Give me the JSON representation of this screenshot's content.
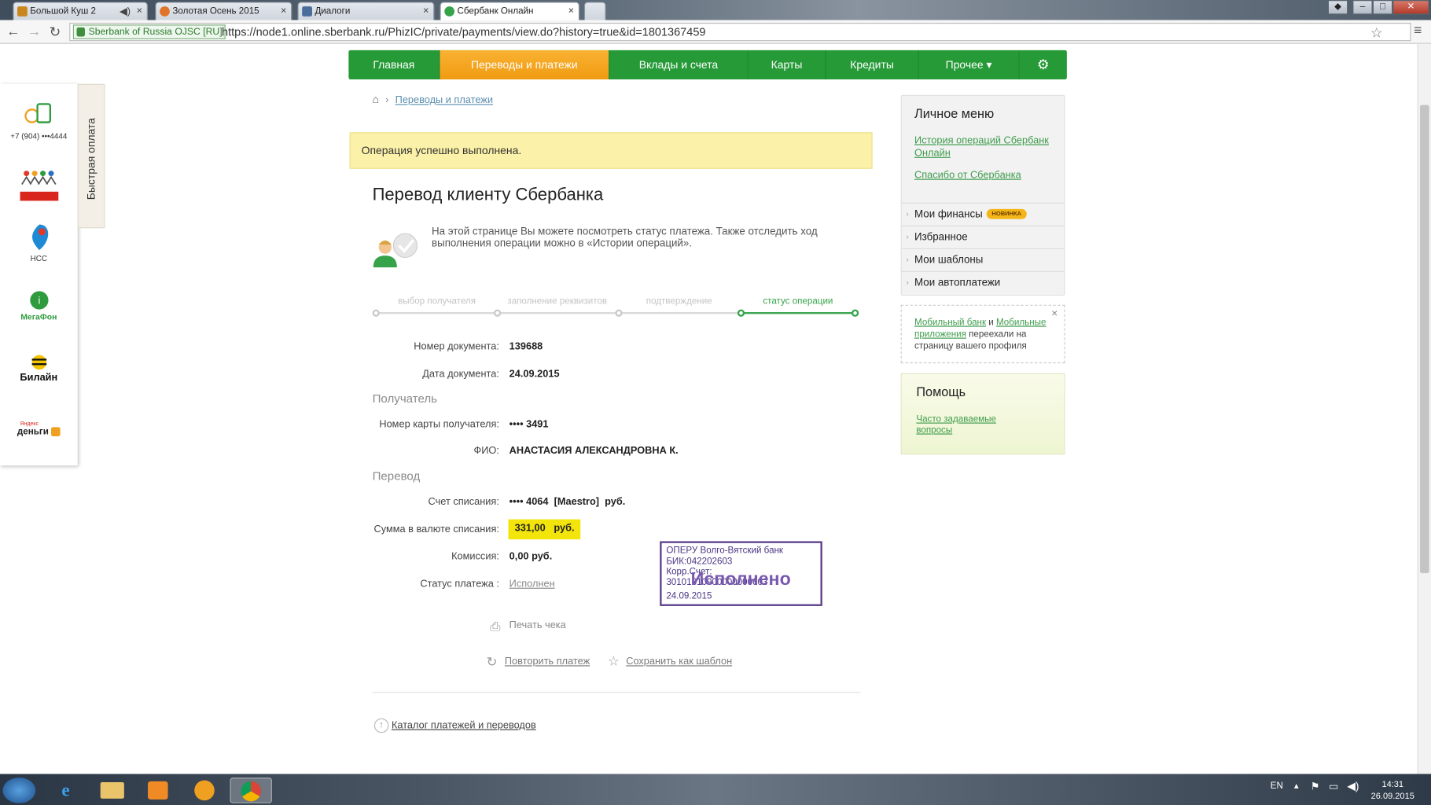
{
  "browser": {
    "tabs": [
      {
        "title": "Большой Куш 2",
        "audio": "◀) ",
        "close": "×"
      },
      {
        "title": "Золотая Осень 2015",
        "close": "×"
      },
      {
        "title": "Диалоги",
        "close": "×"
      },
      {
        "title": "Сбербанк Онлайн",
        "close": "×"
      }
    ],
    "ssl_label": "Sberbank of Russia OJSC [RU]",
    "url": "https://node1.online.sberbank.ru/PhizIC/private/payments/view.do?history=true&id=1801367459",
    "star": "☆",
    "menu": "≡"
  },
  "nav": {
    "items": [
      "Главная",
      "Переводы и платежи",
      "Вклады и счета",
      "Карты",
      "Кредиты",
      "Прочее ▾"
    ],
    "active_index": 1,
    "settings_icon": "⚙"
  },
  "quickpay": {
    "tab_label": "Быстрая оплата",
    "phone": "+7 (904) •••4444",
    "ncc_label": "НСС",
    "megafon": "МегаФон",
    "beeline": "Билайн",
    "yandex_small": "Яндекс",
    "yandex_big": "деньги"
  },
  "breadcrumb": {
    "home_icon": "⌂",
    "sep": "›",
    "link": "Переводы и платежи"
  },
  "success_message": "Операция успешно выполнена.",
  "page_title": "Перевод клиенту Сбербанка",
  "info_text": "На этой странице Вы можете посмотреть статус платежа. Также отследить ход выполнения операции можно в «Истории операций».",
  "steps": [
    "выбор получателя",
    "заполнение реквизитов",
    "подтверждение",
    "статус операции"
  ],
  "details": {
    "doc_number_label": "Номер документа:",
    "doc_number": "139688",
    "doc_date_label": "Дата документа:",
    "doc_date": "24.09.2015",
    "recipient_section": "Получатель",
    "card_label": "Номер карты получателя:",
    "card_value": "•••• 3491",
    "fio_label": "ФИО:",
    "fio_value": "АНАСТАСИЯ АЛЕКСАНДРОВНА К.",
    "transfer_section": "Перевод",
    "account_label": "Счет списания:",
    "account_value": "•••• 4064  [Maestro]  руб.",
    "sum_label": "Сумма в валюте списания:",
    "sum_value": "331,00   руб.",
    "commission_label": "Комиссия:",
    "commission_value": "0,00 руб.",
    "status_label": "Статус платежа :",
    "status_value": "Исполнен"
  },
  "stamp": {
    "line1": "ОПЕРУ Волго-Вятский банк",
    "line2": "БИК:042202603",
    "line3": "Корр.Счет: 30101810900000000603",
    "big": "Исполнено",
    "date": "24.09.2015"
  },
  "actions": {
    "print": "Печать чека",
    "repeat": "Повторить платеж",
    "save_template": "Сохранить как шаблон",
    "catalog": "Каталог платежей и переводов"
  },
  "personal_menu": {
    "title": "Личное меню",
    "link1": "История операций Сбербанк Онлайн",
    "link2": "Спасибо от Сбербанка",
    "items": [
      "Мои финансы",
      "Избранное",
      "Мои шаблоны",
      "Мои автоплатежи"
    ],
    "new_badge": "НОВИНКА"
  },
  "notice": {
    "part1": "Мобильный банк",
    "part2": " и ",
    "part3": "Мобильные приложения",
    "part4": " переехали на страницу вашего профиля",
    "close": "×"
  },
  "help": {
    "title": "Помощь",
    "link": "Часто задаваемые вопросы"
  },
  "taskbar": {
    "lang": "EN",
    "time": "14:31",
    "date": "26.09.2015"
  },
  "colors": {
    "brand_green": "#259a37",
    "active_orange": "#f3a21c",
    "highlight_yellow": "#f3e50b",
    "stamp_purple": "#5a3d8a"
  }
}
